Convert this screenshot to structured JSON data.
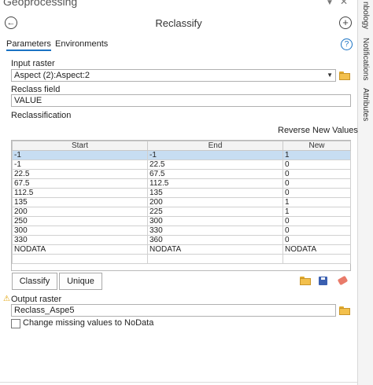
{
  "pane": {
    "title": "Geoprocessing",
    "pin_icon": "pin-icon",
    "close_icon": "close-icon"
  },
  "side_tabs": [
    "nbology",
    "Notifications",
    "Attributes"
  ],
  "tool": {
    "title": "Reclassify"
  },
  "tabs": [
    {
      "label": "Parameters",
      "active": true
    },
    {
      "label": "Environments",
      "active": false
    }
  ],
  "help_label": "?",
  "input_raster": {
    "label": "Input raster",
    "value": "Aspect (2):Aspect:2"
  },
  "reclass_field": {
    "label": "Reclass field",
    "value": "VALUE"
  },
  "reclassification": {
    "label": "Reclassification",
    "reverse_label": "Reverse New Values",
    "columns": [
      "Start",
      "End",
      "New"
    ],
    "rows": [
      [
        "-1",
        "-1",
        "1"
      ],
      [
        "-1",
        "22.5",
        "0"
      ],
      [
        "22.5",
        "67.5",
        "0"
      ],
      [
        "67.5",
        "112.5",
        "0"
      ],
      [
        "112.5",
        "135",
        "0"
      ],
      [
        "135",
        "200",
        "1"
      ],
      [
        "200",
        "225",
        "1"
      ],
      [
        "250",
        "300",
        "0"
      ],
      [
        "300",
        "330",
        "0"
      ],
      [
        "330",
        "360",
        "0"
      ],
      [
        "NODATA",
        "NODATA",
        "NODATA"
      ],
      [
        "",
        "",
        ""
      ]
    ],
    "selected_row": 0
  },
  "buttons": {
    "classify": "Classify",
    "unique": "Unique"
  },
  "output_raster": {
    "label": "Output raster",
    "value": "Reclass_Aspe5"
  },
  "nodata_option": {
    "label": "Change missing values to NoData",
    "checked": false
  },
  "colors": {
    "accent": "#1a72c4",
    "selection": "#c7ddf2",
    "folder": "#f3c04c",
    "warning": "#e0a000"
  }
}
